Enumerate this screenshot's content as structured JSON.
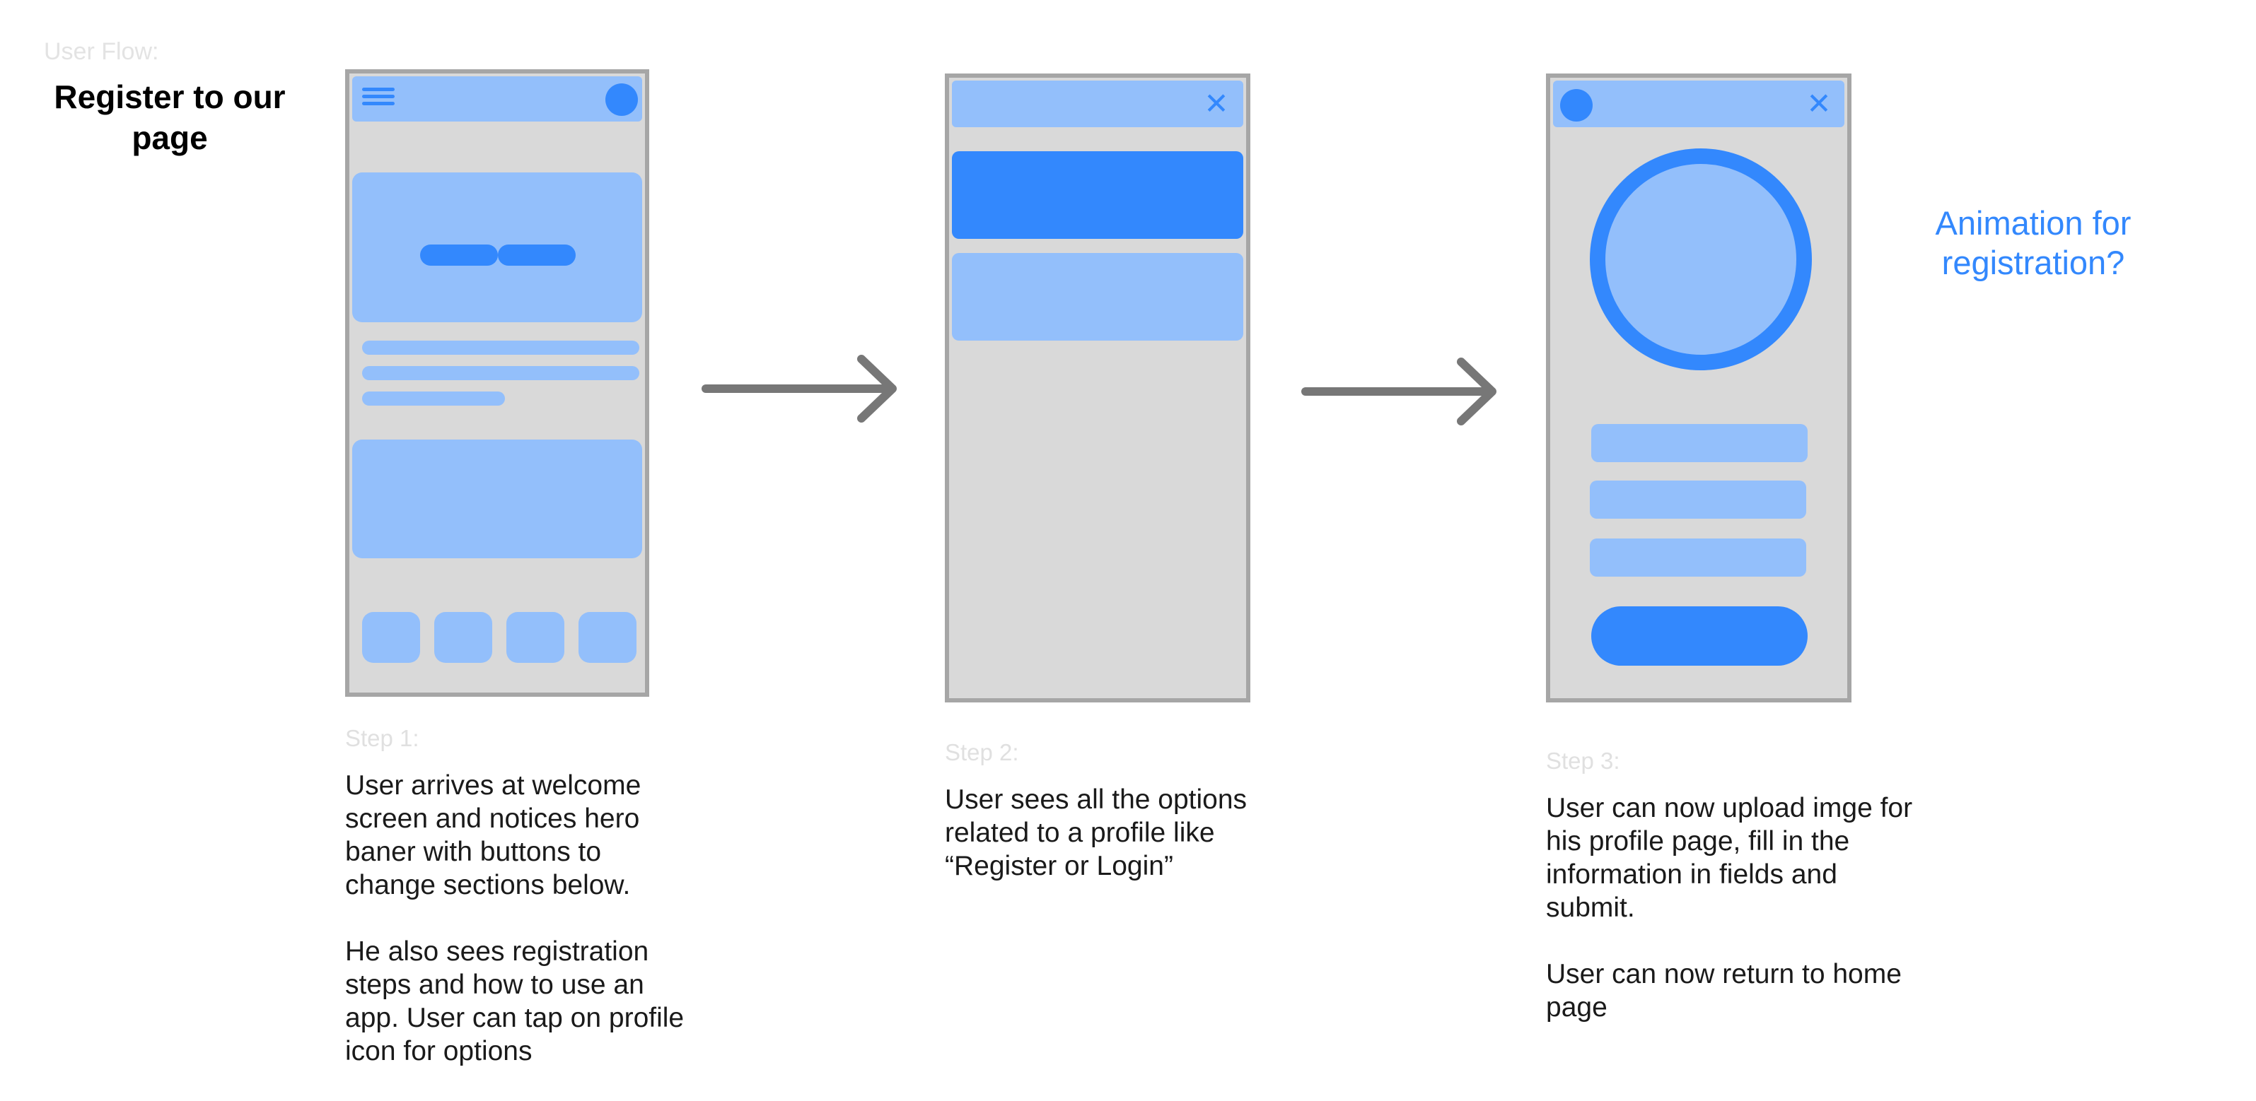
{
  "header": {
    "flow_label": "User Flow:",
    "flow_title": "Register to our page"
  },
  "steps": [
    {
      "label": "Step 1:",
      "paragraphs": [
        "User arrives at welcome screen and notices hero baner with buttons to change sections below.",
        "He also sees registration steps and how to use an app. User can tap on profile icon for options"
      ]
    },
    {
      "label": "Step 2:",
      "paragraphs": [
        "User sees all the options related to a profile like “Register or Login”"
      ]
    },
    {
      "label": "Step 3:",
      "paragraphs": [
        "User can now upload imge for his profile page, fill in the information in fields and submit.",
        "User can now return to home page"
      ]
    }
  ],
  "note": "Animation for registration?",
  "icons": {
    "menu": "hamburger-icon",
    "profile": "avatar-icon",
    "close": "close-icon",
    "arrow": "right-arrow-icon",
    "close_glyph": "✕"
  },
  "colors": {
    "light_blue": "#93bffb",
    "accent_blue": "#3388fd",
    "phone_bg": "#d9d9d9",
    "phone_border": "#a6a6a6",
    "arrow": "#777777"
  }
}
